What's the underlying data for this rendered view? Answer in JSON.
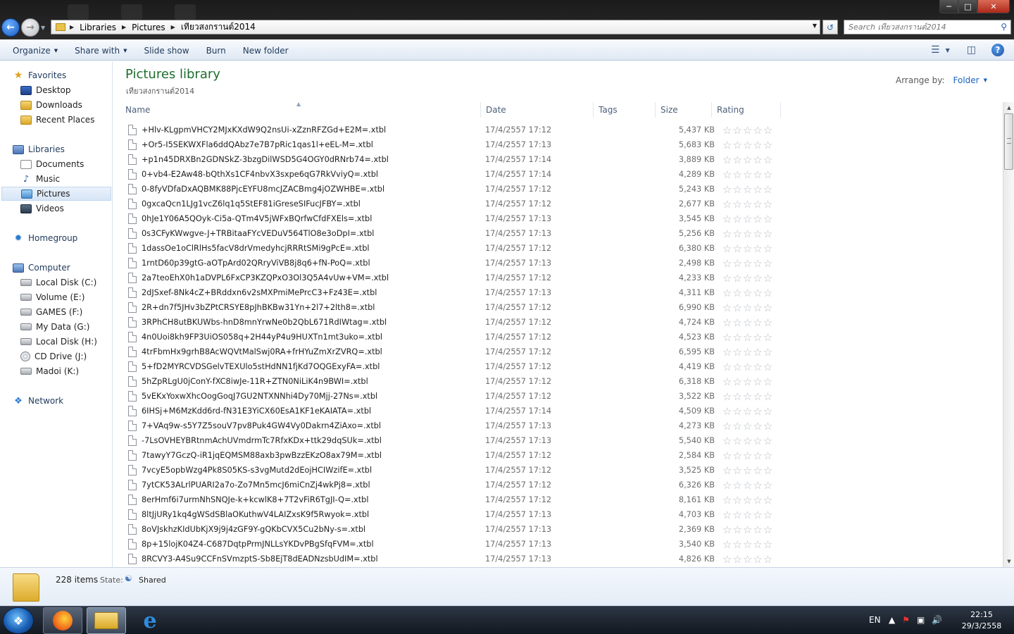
{
  "address": {
    "crumbs": [
      "Libraries",
      "Pictures",
      "เทียวสงกรานต์2014"
    ]
  },
  "search": {
    "placeholder": "Search เทียวสงกรานต์2014"
  },
  "toolbar": {
    "organize": "Organize",
    "share_with": "Share with",
    "slide_show": "Slide show",
    "burn": "Burn",
    "new_folder": "New folder"
  },
  "sidebar": {
    "favorites": "Favorites",
    "desktop": "Desktop",
    "downloads": "Downloads",
    "recent_places": "Recent Places",
    "libraries": "Libraries",
    "documents": "Documents",
    "music": "Music",
    "pictures": "Pictures",
    "videos": "Videos",
    "homegroup": "Homegroup",
    "computer": "Computer",
    "drives": [
      "Local Disk (C:)",
      "Volume (E:)",
      "GAMES (F:)",
      "My Data (G:)",
      "Local Disk (H:)",
      "CD Drive (J:)",
      "Madoi (K:)"
    ],
    "network": "Network"
  },
  "library": {
    "title": "Pictures library",
    "subtitle": "เทียวสงกรานต์2014",
    "arrange_label": "Arrange by:",
    "arrange_value": "Folder"
  },
  "columns": {
    "name": "Name",
    "date": "Date",
    "tags": "Tags",
    "size": "Size",
    "rating": "Rating"
  },
  "files": [
    {
      "name": "+Hlv-KLgpmVHCY2MJxKXdW9Q2nsUi-xZznRFZGd+E2M=.xtbl",
      "date": "17/4/2557 17:12",
      "size": "5,437 KB"
    },
    {
      "name": "+Or5-I5SEKWXFla6ddQAbz7e7B7pRic1qas1l+eEL-M=.xtbl",
      "date": "17/4/2557 17:13",
      "size": "5,683 KB"
    },
    {
      "name": "+p1n45DRXBn2GDNSkZ-3bzgDilWSD5G4OGY0dRNrb74=.xtbl",
      "date": "17/4/2557 17:14",
      "size": "3,889 KB"
    },
    {
      "name": "0+vb4-E2Aw48-bQthXs1CF4nbvX3sxpe6qG7RkVviyQ=.xtbl",
      "date": "17/4/2557 17:14",
      "size": "4,289 KB"
    },
    {
      "name": "0-8fyVDfaDxAQBMK88PjcEYFU8mcJZACBmg4jOZWHBE=.xtbl",
      "date": "17/4/2557 17:12",
      "size": "5,243 KB"
    },
    {
      "name": "0gxcaQcn1LJg1vcZ6lq1q5StEF81iGreseSIFucJFBY=.xtbl",
      "date": "17/4/2557 17:12",
      "size": "2,677 KB"
    },
    {
      "name": "0hJe1Y06A5QOyk-Ci5a-QTm4V5jWFxBQrfwCfdFXEls=.xtbl",
      "date": "17/4/2557 17:13",
      "size": "3,545 KB"
    },
    {
      "name": "0s3CFyKWwgve-J+TRBitaaFYcVEDuV564TlO8e3oDpI=.xtbl",
      "date": "17/4/2557 17:13",
      "size": "5,256 KB"
    },
    {
      "name": "1dassOe1oClRlHs5facV8drVmedyhcjRRRtSMi9gPcE=.xtbl",
      "date": "17/4/2557 17:12",
      "size": "6,380 KB"
    },
    {
      "name": "1rntD60p39gtG-aOTpArd02QRryViVB8j8q6+fN-PoQ=.xtbl",
      "date": "17/4/2557 17:13",
      "size": "2,498 KB"
    },
    {
      "name": "2a7teoEhX0h1aDVPL6FxCP3KZQPxO3Ol3Q5A4vUw+VM=.xtbl",
      "date": "17/4/2557 17:12",
      "size": "4,233 KB"
    },
    {
      "name": "2dJSxef-8Nk4cZ+BRddxn6v2sMXPmiMePrcC3+Fz43E=.xtbl",
      "date": "17/4/2557 17:13",
      "size": "4,311 KB"
    },
    {
      "name": "2R+dn7f5JHv3bZPtCRSYE8pJhBKBw31Yn+2l7+2lth8=.xtbl",
      "date": "17/4/2557 17:12",
      "size": "6,990 KB"
    },
    {
      "name": "3RPhCH8utBKUWbs-hnD8mnYrwNe0b2QbL671RdIWtag=.xtbl",
      "date": "17/4/2557 17:12",
      "size": "4,724 KB"
    },
    {
      "name": "4n0Uoi8kh9FP3UiOS058q+2H44yP4u9HUXTn1mt3uko=.xtbl",
      "date": "17/4/2557 17:12",
      "size": "4,523 KB"
    },
    {
      "name": "4trFbmHx9grhB8AcWQVtMalSwj0RA+frHYuZmXrZVRQ=.xtbl",
      "date": "17/4/2557 17:12",
      "size": "6,595 KB"
    },
    {
      "name": "5+fD2MYRCVDSGelvTEXUlo5stHdNN1fjKd7OQGExyFA=.xtbl",
      "date": "17/4/2557 17:12",
      "size": "4,419 KB"
    },
    {
      "name": "5hZpRLgU0jConY-fXC8iwJe-11R+ZTN0NiLiK4n9BWI=.xtbl",
      "date": "17/4/2557 17:12",
      "size": "6,318 KB"
    },
    {
      "name": "5vEKxYoxwXhcOogGoqJ7GU2NTXNNhi4Dy70Mjj-27Ns=.xtbl",
      "date": "17/4/2557 17:12",
      "size": "3,522 KB"
    },
    {
      "name": "6IHSj+M6MzKdd6rd-fN31E3YiCX60EsA1KF1eKAIATA=.xtbl",
      "date": "17/4/2557 17:14",
      "size": "4,509 KB"
    },
    {
      "name": "7+VAq9w-s5Y7Z5souV7pv8Puk4GW4Vy0Dakrn4ZiAxo=.xtbl",
      "date": "17/4/2557 17:13",
      "size": "4,273 KB"
    },
    {
      "name": "-7LsOVHEYBRtnmAchUVmdrmTc7RfxKDx+ttk29dqSUk=.xtbl",
      "date": "17/4/2557 17:13",
      "size": "5,540 KB"
    },
    {
      "name": "7tawyY7GczQ-iR1jqEQMSM88axb3pwBzzEKzO8ax79M=.xtbl",
      "date": "17/4/2557 17:12",
      "size": "2,584 KB"
    },
    {
      "name": "7vcyE5opbWzg4Pk8S05KS-s3vgMutd2dEojHCIWzifE=.xtbl",
      "date": "17/4/2557 17:12",
      "size": "3,525 KB"
    },
    {
      "name": "7ytCK53ALrlPUARI2a7o-Zo7Mn5mcJ6miCnZj4wkPj8=.xtbl",
      "date": "17/4/2557 17:12",
      "size": "6,326 KB"
    },
    {
      "name": "8erHmf6i7urmNhSNQJe-k+kcwlK8+7T2vFiR6TgJI-Q=.xtbl",
      "date": "17/4/2557 17:12",
      "size": "8,161 KB"
    },
    {
      "name": "8ltJjURy1kq4gWSdSBlaOKuthwV4LAIZxsK9f5Rwyok=.xtbl",
      "date": "17/4/2557 17:13",
      "size": "4,703 KB"
    },
    {
      "name": "8oVJskhzKIdUbKjX9j9j4zGF9Y-gQKbCVX5Cu2bNy-s=.xtbl",
      "date": "17/4/2557 17:13",
      "size": "2,369 KB"
    },
    {
      "name": "8p+15lojK04Z4-C687DqtpPrmJNLLsYKDvPBgSfqFVM=.xtbl",
      "date": "17/4/2557 17:13",
      "size": "3,540 KB"
    },
    {
      "name": "8RCVY3-A4Su9CCFnSVmzptS-Sb8EjT8dEADNzsbUdIM=.xtbl",
      "date": "17/4/2557 17:13",
      "size": "4,826 KB"
    }
  ],
  "details": {
    "items_count": "228 items",
    "state_label": "State:",
    "state_value": "Shared"
  },
  "taskbar": {
    "lang": "EN",
    "time": "22:15",
    "date": "29/3/2558"
  }
}
